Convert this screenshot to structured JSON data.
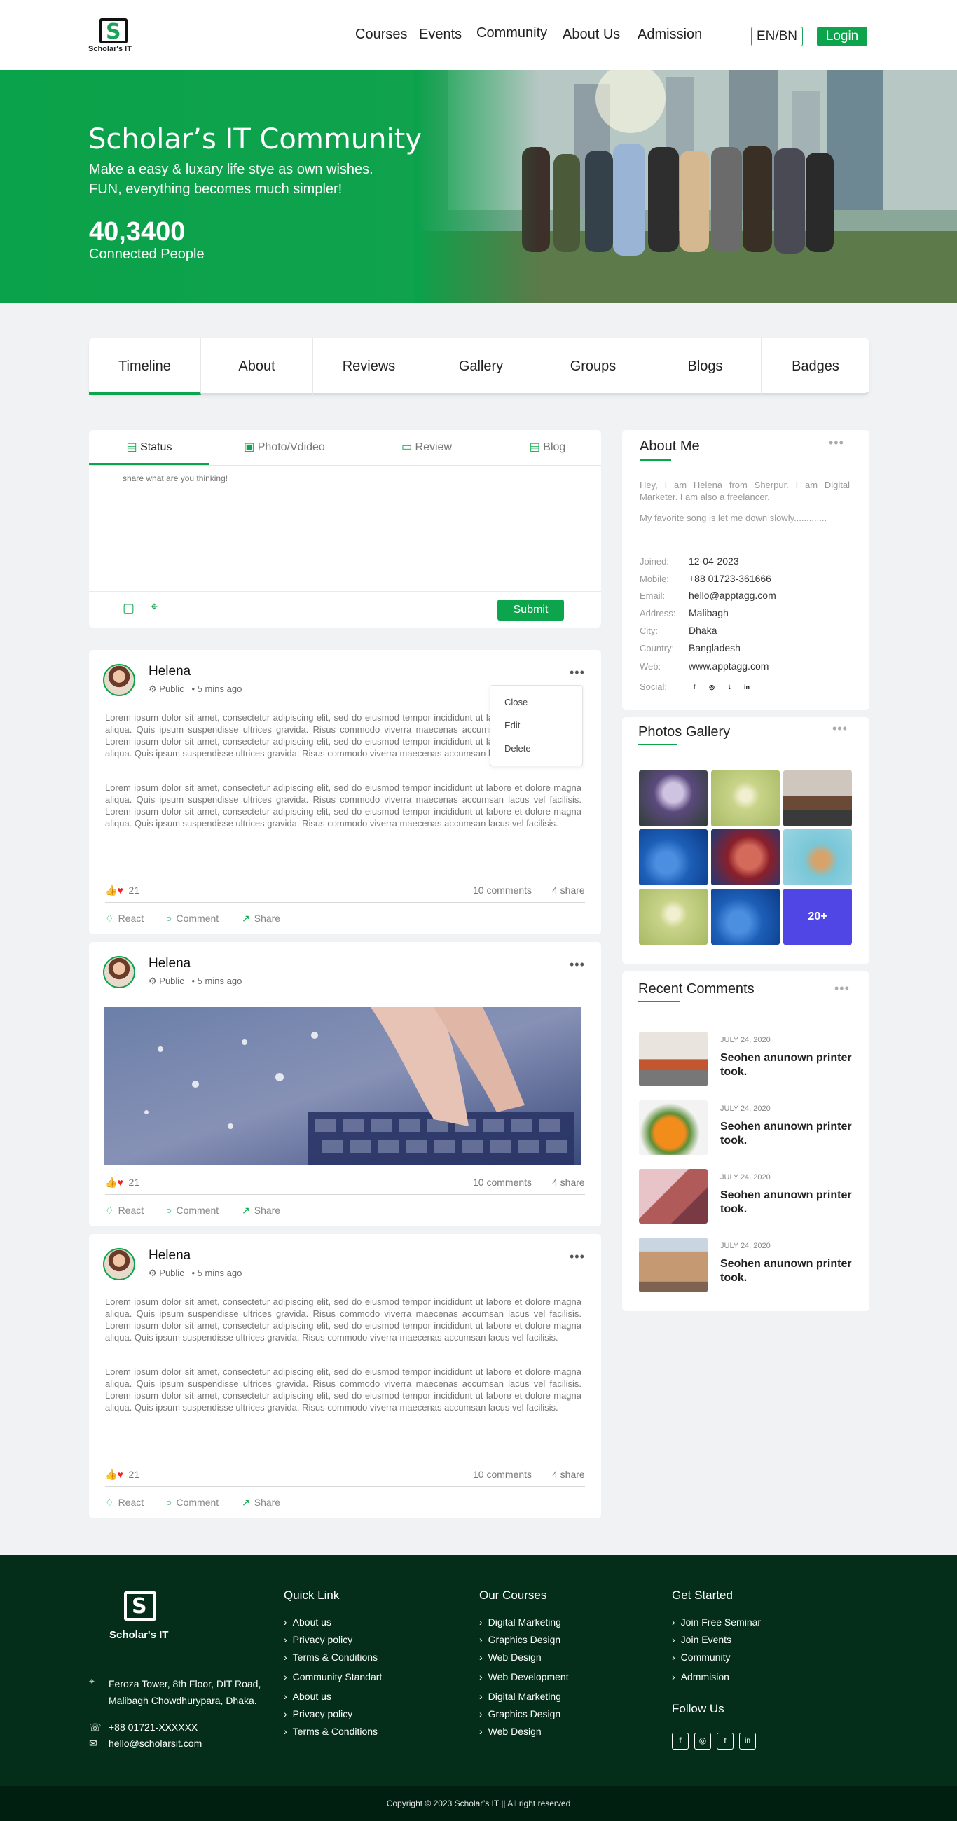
{
  "brand": {
    "name": "Scholar's IT",
    "accent": "#0da54b",
    "dark": "#042e1a"
  },
  "nav": {
    "items": [
      "Courses",
      "Events",
      "Community",
      "About Us",
      "Admission"
    ],
    "lang": "EN/BN",
    "login": "Login"
  },
  "hero": {
    "title": "Scholar’s IT Community",
    "subtitle_1": "Make a easy & luxary life stye as own wishes.",
    "subtitle_2": "FUN, everything becomes much simpler!",
    "count": "40,3400",
    "count_label": "Connected People"
  },
  "tabs": [
    "Timeline",
    "About",
    "Reviews",
    "Gallery",
    "Groups",
    "Blogs",
    "Badges"
  ],
  "composer": {
    "tabs": [
      "Status",
      "Photo/Vdideo",
      "Review",
      "Blog"
    ],
    "placeholder": "share what are you thinking!",
    "submit": "Submit"
  },
  "posts": [
    {
      "author": "Helena",
      "visibility": "Public",
      "time": "5 mins ago",
      "para1": "Lorem ipsum dolor sit amet, consectetur adipiscing elit, sed do eiusmod tempor incididunt ut labore et dolore magna aliqua. Quis ipsum suspendisse ultrices gravida. Risus commodo viverra maecenas accumsan lacus vel facilisis. Lorem ipsum dolor sit amet, consectetur adipiscing elit, sed do eiusmod tempor incididunt ut labore et dolore magna aliqua. Quis ipsum suspendisse ultrices gravida. Risus commodo viverra maecenas accumsan lacus vel facilisis.",
      "para2": "Lorem ipsum dolor sit amet, consectetur adipiscing elit, sed do eiusmod tempor incididunt ut labore et dolore magna aliqua. Quis ipsum suspendisse ultrices gravida. Risus commodo viverra maecenas accumsan lacus vel facilisis. Lorem ipsum dolor sit amet, consectetur adipiscing elit, sed do eiusmod tempor incididunt ut labore et dolore magna aliqua. Quis ipsum suspendisse ultrices gravida. Risus commodo viverra maecenas accumsan lacus vel facilisis.",
      "reactions": "21",
      "comments": "10 comments",
      "shares": "4 share"
    },
    {
      "author": "Helena",
      "visibility": "Public",
      "time": "5 mins ago",
      "reactions": "21",
      "comments": "10 comments",
      "shares": "4 share"
    },
    {
      "author": "Helena",
      "visibility": "Public",
      "time": "5 mins ago",
      "para1": "Lorem ipsum dolor sit amet, consectetur adipiscing elit, sed do eiusmod tempor incididunt ut labore et dolore magna aliqua. Quis ipsum suspendisse ultrices gravida. Risus commodo viverra maecenas accumsan lacus vel facilisis. Lorem ipsum dolor sit amet, consectetur adipiscing elit, sed do eiusmod tempor incididunt ut labore et dolore magna aliqua. Quis ipsum suspendisse ultrices gravida. Risus commodo viverra maecenas accumsan lacus vel facilisis.",
      "para2": "Lorem ipsum dolor sit amet, consectetur adipiscing elit, sed do eiusmod tempor incididunt ut labore et dolore magna aliqua. Quis ipsum suspendisse ultrices gravida. Risus commodo viverra maecenas accumsan lacus vel facilisis. Lorem ipsum dolor sit amet, consectetur adipiscing elit, sed do eiusmod tempor incididunt ut labore et dolore magna aliqua. Quis ipsum suspendisse ultrices gravida. Risus commodo viverra maecenas accumsan lacus vel facilisis.",
      "reactions": "21",
      "comments": "10 comments",
      "shares": "4 share"
    }
  ],
  "post_actions": {
    "react": "React",
    "comment": "Comment",
    "share": "Share"
  },
  "dropdown": [
    "Close",
    "Edit",
    "Delete"
  ],
  "about": {
    "title": "About Me",
    "bio": "Hey, I am Helena from Sherpur. I am Digital Marketer. I am also a freelancer.",
    "song": "My favorite song is let me down slowly.............",
    "fields": [
      {
        "k": "Joined:",
        "v": "12-04-2023"
      },
      {
        "k": "Mobile:",
        "v": "+88 01723-361666"
      },
      {
        "k": "Email:",
        "v": "hello@apptagg.com"
      },
      {
        "k": "Address:",
        "v": "Malibagh"
      },
      {
        "k": "City:",
        "v": "Dhaka"
      },
      {
        "k": "Country:",
        "v": "Bangladesh"
      },
      {
        "k": "Web:",
        "v": "www.apptagg.com"
      }
    ],
    "social_label": "Social:",
    "social": [
      "f",
      "◎",
      "t",
      "in"
    ]
  },
  "gallery": {
    "title": "Photos Gallery",
    "more": "20+"
  },
  "recent": {
    "title": "Recent Comments",
    "items": [
      {
        "date": "JULY 24, 2020",
        "title": "Seohen anunown printer took."
      },
      {
        "date": "JULY 24, 2020",
        "title": "Seohen anunown printer took."
      },
      {
        "date": "JULY 24, 2020",
        "title": "Seohen anunown printer took."
      },
      {
        "date": "JULY 24, 2020",
        "title": "Seohen anunown printer took."
      }
    ]
  },
  "footer": {
    "address_1": "Feroza Tower, 8th Floor, DIT Road,",
    "address_2": "Malibagh Chowdhurypara, Dhaka.",
    "phone": "+88 01721-XXXXXX",
    "email": "hello@scholarsit.com",
    "quick_title": "Quick Link",
    "quick": [
      "About us",
      "Privacy policy",
      "Terms & Conditions",
      "Community Standart",
      "About us",
      "Privacy policy",
      "Terms & Conditions"
    ],
    "courses_title": "Our Courses",
    "courses": [
      "Digital Marketing",
      "Graphics Design",
      "Web Design",
      "Web Development",
      "Digital Marketing",
      "Graphics Design",
      "Web Design"
    ],
    "started_title": "Get Started",
    "started": [
      "Join Free Seminar",
      "Join Events",
      "Community",
      "Admmision"
    ],
    "follow_title": "Follow Us",
    "social": [
      "f",
      "◎",
      "t",
      "in"
    ],
    "copyright": "Copyright © 2023 Scholar’s IT || All right reserved"
  }
}
